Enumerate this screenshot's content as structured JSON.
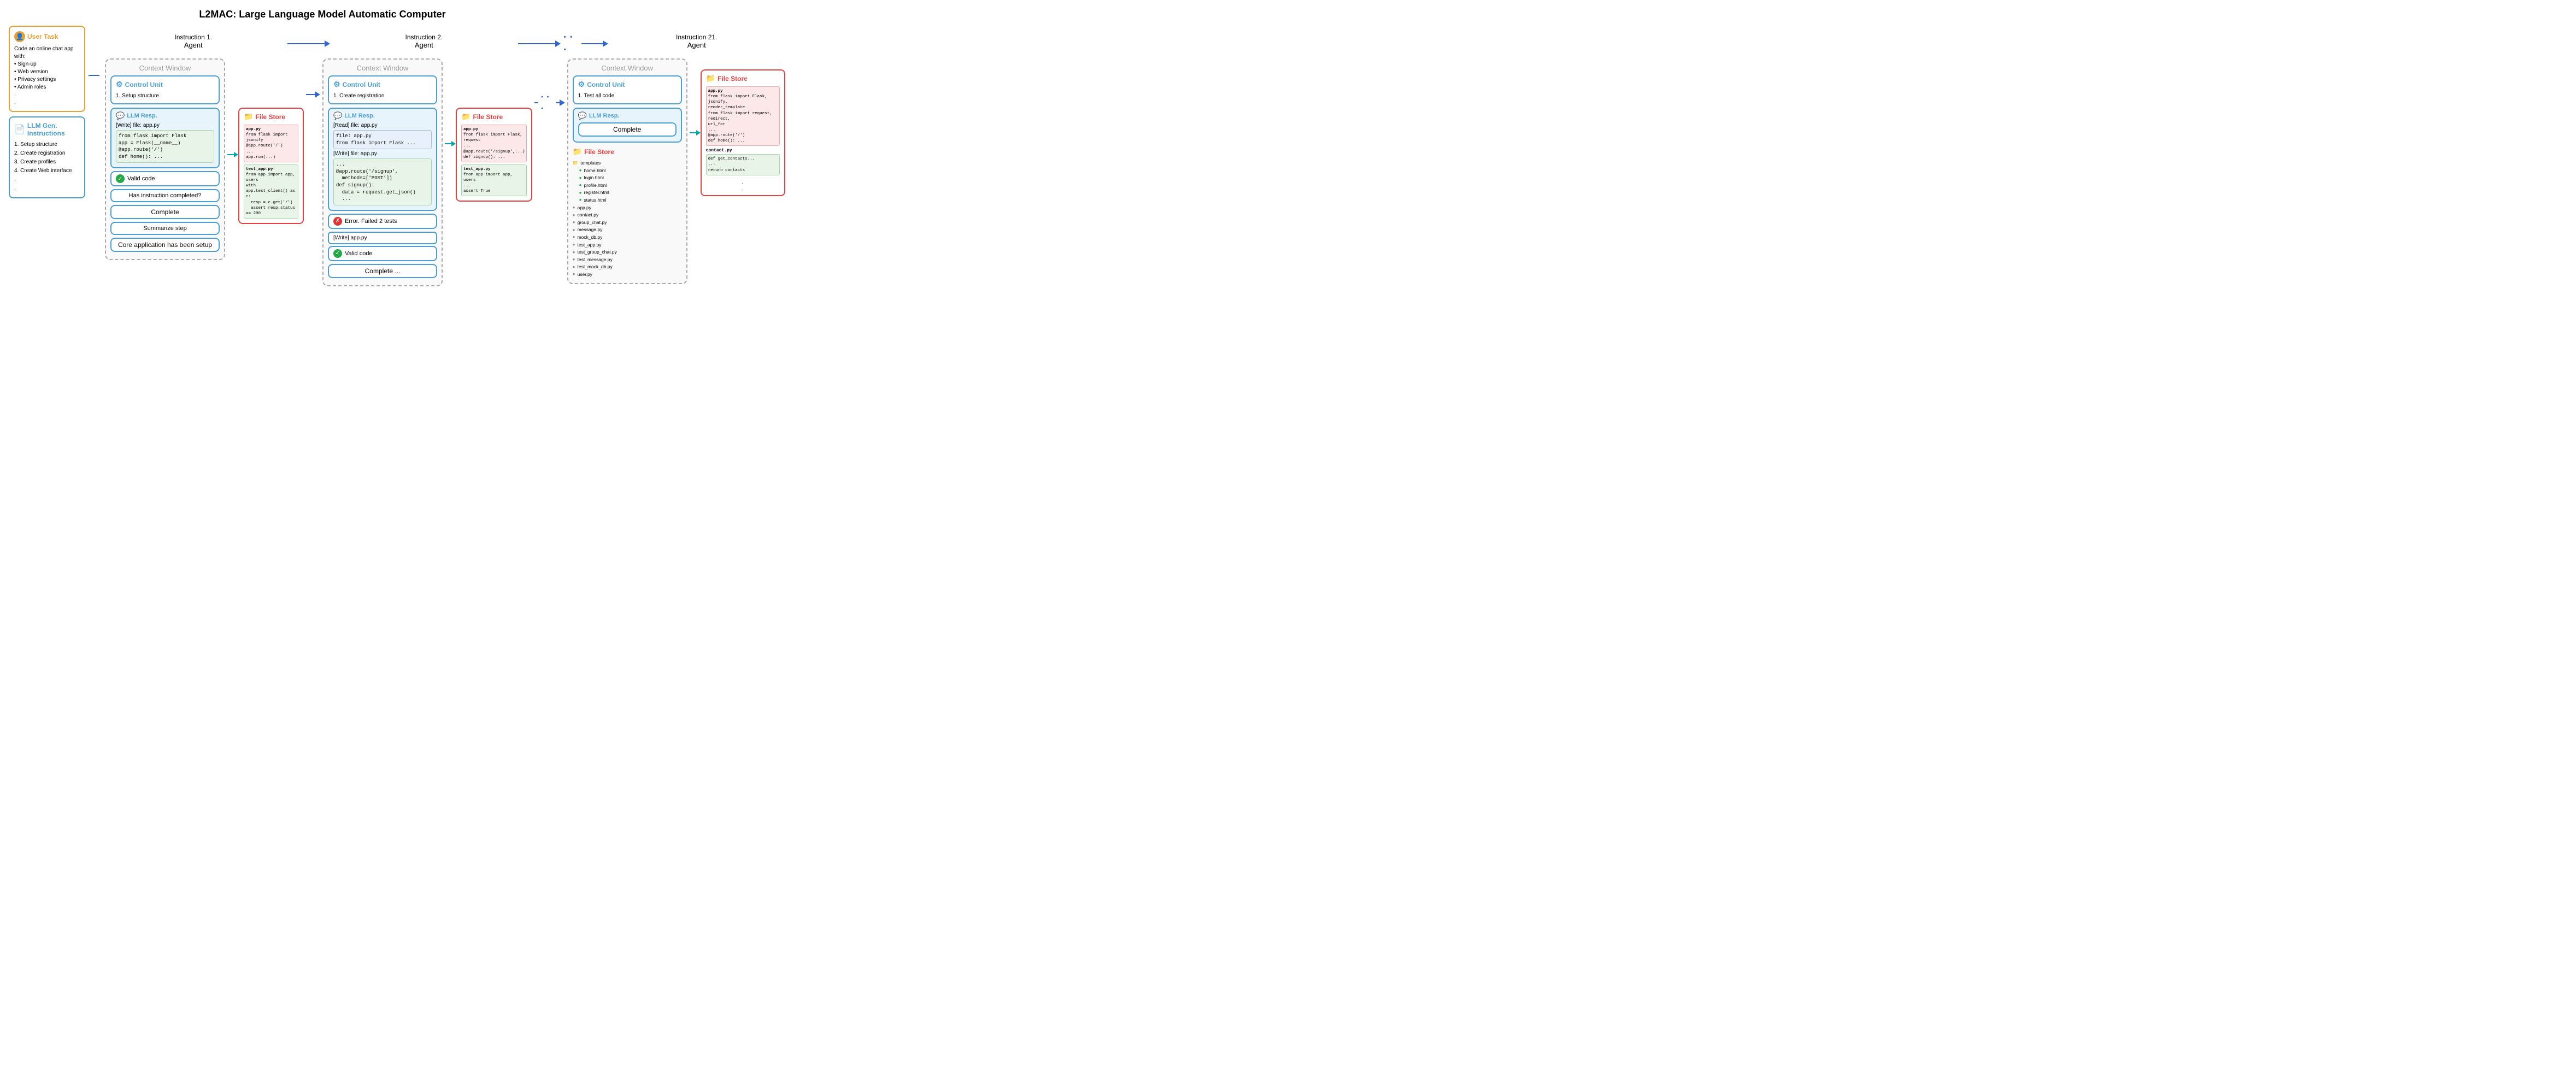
{
  "title": "L2MAC: Large Language Model Automatic Computer",
  "user_task": {
    "header": "User Task",
    "content": "Code an online chat app with:\n• Sign-up\n• Web version\n• Privacy settings\n• Admin roles\n.\n."
  },
  "llm_gen": {
    "header": "LLM Gen. Instructions",
    "items": [
      "1. Setup structure",
      "2. Create registration",
      "3. Create profiles",
      "4. Create Web interface",
      ".",
      "."
    ]
  },
  "instruction1": {
    "label": "Instruction 1.",
    "sub": "Agent",
    "context_label": "Context Window",
    "control_unit_label": "Control Unit",
    "instruction_text": "1.  Setup structure",
    "llm_resp_label": "LLM Resp.",
    "write_file": "[Write] file: app.py",
    "code": "from flask import Flask\napp = Flask(__name__)\n@app.route('/')\ndef home(): ...",
    "valid_code": "Valid code",
    "has_instruction": "Has instruction completed?",
    "complete": "Complete",
    "summarize": "Summarize step",
    "summary_text": "Core application has been setup"
  },
  "file_store1": {
    "header": "File Store",
    "app_py_lines": [
      "from flask import jsonify",
      "@app.route('/')",
      "...",
      "app.run(...)"
    ],
    "test_app_lines": [
      "from app import app, users",
      "with app.test_client() as c:",
      "  resp = c.get('/')",
      "  assert resp.status_code == 200"
    ]
  },
  "instruction2": {
    "label": "Instruction 2.",
    "sub": "Agent",
    "context_label": "Context Window",
    "control_unit_label": "Control Unit",
    "instruction_text": "1.  Create registration",
    "llm_resp_label": "LLM Resp.",
    "read_file": "[Read] file: app.py",
    "file_content": "file: app.py\nfrom flask import Flask ...",
    "write_file": "[Write] file: app.py",
    "code2": "...\n@app.route('/signup',\n  methods=['POST'])\ndef signup():\n  data = request.get_json()\n  ...",
    "error_text": "Error. Failed 2 tests",
    "write_file2": "[Write] app.py",
    "valid_code": "Valid code",
    "complete": "Complete ..."
  },
  "file_store2": {
    "header": "File Store",
    "app_py_lines": [
      "from flask import Flask, request",
      "...",
      "@app.route('/signup', methods=['POST'])",
      "def signup(): ..."
    ],
    "test_app_lines": [
      "from app import app, users",
      "...",
      "assert True"
    ]
  },
  "instruction21": {
    "label": "Instruction 21.",
    "sub": "Agent",
    "context_label": "Context Window",
    "control_unit_label": "Control Unit",
    "instruction_text": "1.  Test all code",
    "llm_resp_label": "LLM Resp.",
    "complete": "Complete"
  },
  "file_store3": {
    "header": "File Store",
    "folders": [
      "templates"
    ],
    "template_files": [
      "home.html",
      "login.html",
      "profile.html",
      "register.html",
      "status.html"
    ],
    "py_files": [
      "app.py",
      "contact.py",
      "group_chat.py",
      "message.py",
      "mock_db.py",
      "test_app.py",
      "test_group_chat.py",
      "test_message.py",
      "test_mock_db.py",
      "user.py"
    ]
  },
  "file_store4": {
    "header": "File Store",
    "app_py_lines": [
      "from flask import Flask, jsonify, render_template",
      "from flask import request, redirect, url_for",
      "...",
      "@app.route('/')",
      "def home(): ..."
    ],
    "contact_py_label": "contact.py",
    "contact_py_lines": [
      "def get_contacts...",
      "...",
      "return contacts"
    ]
  }
}
